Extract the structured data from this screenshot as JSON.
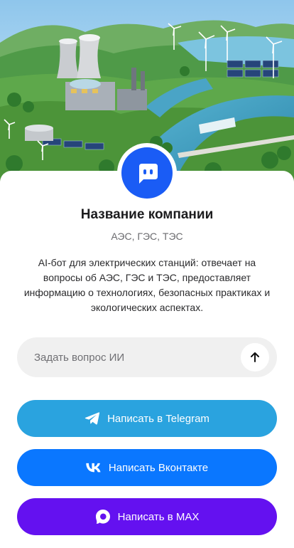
{
  "company": {
    "name": "Название компании",
    "tags": "АЭС, ГЭС, ТЭС",
    "description": "AI-бот для электрических станций: отвечает на вопросы об АЭС, ГЭС и ТЭС, предоставляет информацию о технологиях, безопасных практиках и экологических аспектах."
  },
  "avatar": {
    "icon": "chat-bot-icon",
    "color": "#1a5cf5"
  },
  "ask": {
    "placeholder": "Задать вопрос ИИ",
    "value": "",
    "send_icon": "arrow-up-icon"
  },
  "buttons": {
    "telegram": {
      "label": "Написать в Telegram",
      "icon": "telegram-icon",
      "color": "#2aa3df"
    },
    "vk": {
      "label": "Написать Вконтакте",
      "icon": "vk-icon",
      "color": "#0a77ff"
    },
    "max": {
      "label": "Написать в MAX",
      "icon": "max-icon",
      "color": "#6411f0"
    }
  }
}
